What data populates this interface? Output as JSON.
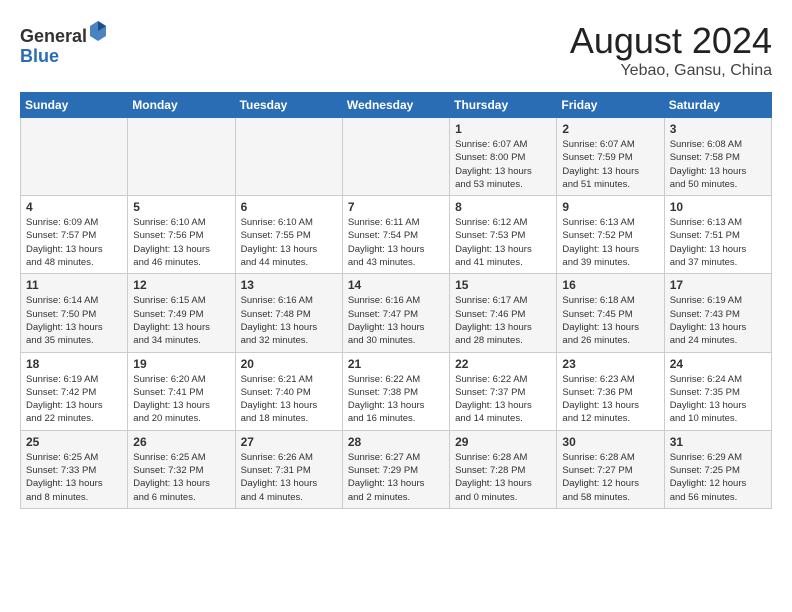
{
  "header": {
    "logo_line1": "General",
    "logo_line2": "Blue",
    "month": "August 2024",
    "location": "Yebao, Gansu, China"
  },
  "weekdays": [
    "Sunday",
    "Monday",
    "Tuesday",
    "Wednesday",
    "Thursday",
    "Friday",
    "Saturday"
  ],
  "weeks": [
    [
      {
        "day": "",
        "info": ""
      },
      {
        "day": "",
        "info": ""
      },
      {
        "day": "",
        "info": ""
      },
      {
        "day": "",
        "info": ""
      },
      {
        "day": "1",
        "info": "Sunrise: 6:07 AM\nSunset: 8:00 PM\nDaylight: 13 hours\nand 53 minutes."
      },
      {
        "day": "2",
        "info": "Sunrise: 6:07 AM\nSunset: 7:59 PM\nDaylight: 13 hours\nand 51 minutes."
      },
      {
        "day": "3",
        "info": "Sunrise: 6:08 AM\nSunset: 7:58 PM\nDaylight: 13 hours\nand 50 minutes."
      }
    ],
    [
      {
        "day": "4",
        "info": "Sunrise: 6:09 AM\nSunset: 7:57 PM\nDaylight: 13 hours\nand 48 minutes."
      },
      {
        "day": "5",
        "info": "Sunrise: 6:10 AM\nSunset: 7:56 PM\nDaylight: 13 hours\nand 46 minutes."
      },
      {
        "day": "6",
        "info": "Sunrise: 6:10 AM\nSunset: 7:55 PM\nDaylight: 13 hours\nand 44 minutes."
      },
      {
        "day": "7",
        "info": "Sunrise: 6:11 AM\nSunset: 7:54 PM\nDaylight: 13 hours\nand 43 minutes."
      },
      {
        "day": "8",
        "info": "Sunrise: 6:12 AM\nSunset: 7:53 PM\nDaylight: 13 hours\nand 41 minutes."
      },
      {
        "day": "9",
        "info": "Sunrise: 6:13 AM\nSunset: 7:52 PM\nDaylight: 13 hours\nand 39 minutes."
      },
      {
        "day": "10",
        "info": "Sunrise: 6:13 AM\nSunset: 7:51 PM\nDaylight: 13 hours\nand 37 minutes."
      }
    ],
    [
      {
        "day": "11",
        "info": "Sunrise: 6:14 AM\nSunset: 7:50 PM\nDaylight: 13 hours\nand 35 minutes."
      },
      {
        "day": "12",
        "info": "Sunrise: 6:15 AM\nSunset: 7:49 PM\nDaylight: 13 hours\nand 34 minutes."
      },
      {
        "day": "13",
        "info": "Sunrise: 6:16 AM\nSunset: 7:48 PM\nDaylight: 13 hours\nand 32 minutes."
      },
      {
        "day": "14",
        "info": "Sunrise: 6:16 AM\nSunset: 7:47 PM\nDaylight: 13 hours\nand 30 minutes."
      },
      {
        "day": "15",
        "info": "Sunrise: 6:17 AM\nSunset: 7:46 PM\nDaylight: 13 hours\nand 28 minutes."
      },
      {
        "day": "16",
        "info": "Sunrise: 6:18 AM\nSunset: 7:45 PM\nDaylight: 13 hours\nand 26 minutes."
      },
      {
        "day": "17",
        "info": "Sunrise: 6:19 AM\nSunset: 7:43 PM\nDaylight: 13 hours\nand 24 minutes."
      }
    ],
    [
      {
        "day": "18",
        "info": "Sunrise: 6:19 AM\nSunset: 7:42 PM\nDaylight: 13 hours\nand 22 minutes."
      },
      {
        "day": "19",
        "info": "Sunrise: 6:20 AM\nSunset: 7:41 PM\nDaylight: 13 hours\nand 20 minutes."
      },
      {
        "day": "20",
        "info": "Sunrise: 6:21 AM\nSunset: 7:40 PM\nDaylight: 13 hours\nand 18 minutes."
      },
      {
        "day": "21",
        "info": "Sunrise: 6:22 AM\nSunset: 7:38 PM\nDaylight: 13 hours\nand 16 minutes."
      },
      {
        "day": "22",
        "info": "Sunrise: 6:22 AM\nSunset: 7:37 PM\nDaylight: 13 hours\nand 14 minutes."
      },
      {
        "day": "23",
        "info": "Sunrise: 6:23 AM\nSunset: 7:36 PM\nDaylight: 13 hours\nand 12 minutes."
      },
      {
        "day": "24",
        "info": "Sunrise: 6:24 AM\nSunset: 7:35 PM\nDaylight: 13 hours\nand 10 minutes."
      }
    ],
    [
      {
        "day": "25",
        "info": "Sunrise: 6:25 AM\nSunset: 7:33 PM\nDaylight: 13 hours\nand 8 minutes."
      },
      {
        "day": "26",
        "info": "Sunrise: 6:25 AM\nSunset: 7:32 PM\nDaylight: 13 hours\nand 6 minutes."
      },
      {
        "day": "27",
        "info": "Sunrise: 6:26 AM\nSunset: 7:31 PM\nDaylight: 13 hours\nand 4 minutes."
      },
      {
        "day": "28",
        "info": "Sunrise: 6:27 AM\nSunset: 7:29 PM\nDaylight: 13 hours\nand 2 minutes."
      },
      {
        "day": "29",
        "info": "Sunrise: 6:28 AM\nSunset: 7:28 PM\nDaylight: 13 hours\nand 0 minutes."
      },
      {
        "day": "30",
        "info": "Sunrise: 6:28 AM\nSunset: 7:27 PM\nDaylight: 12 hours\nand 58 minutes."
      },
      {
        "day": "31",
        "info": "Sunrise: 6:29 AM\nSunset: 7:25 PM\nDaylight: 12 hours\nand 56 minutes."
      }
    ]
  ]
}
